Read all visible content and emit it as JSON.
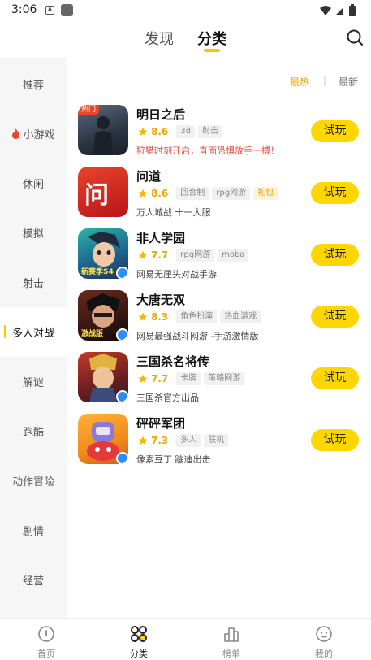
{
  "status_bar": {
    "time": "3:06",
    "notif_letter": "A"
  },
  "header": {
    "tabs": [
      {
        "label": "发现"
      },
      {
        "label": "分类"
      }
    ]
  },
  "sidebar": {
    "items": [
      {
        "label": "推荐"
      },
      {
        "label": "小游戏"
      },
      {
        "label": "休闲"
      },
      {
        "label": "模拟"
      },
      {
        "label": "射击"
      },
      {
        "label": "多人对战"
      },
      {
        "label": "解谜"
      },
      {
        "label": "跑酷"
      },
      {
        "label": "动作冒险"
      },
      {
        "label": "剧情"
      },
      {
        "label": "经营"
      }
    ],
    "active_index": 5
  },
  "sort": {
    "hot": "最热",
    "separator": "|",
    "new": "最新"
  },
  "games": [
    {
      "name": "明日之后",
      "rating": "8.6",
      "tags": [
        "3d",
        "射击"
      ],
      "desc": "狩猎时刻开启，直面恐惧放手一搏！",
      "badge": "热门",
      "button": "试玩"
    },
    {
      "name": "问道",
      "rating": "8.6",
      "tags": [
        "回合制",
        "rpg网游",
        "礼包"
      ],
      "desc": "万人城战 十一大服",
      "icon_text": "问道",
      "button": "试玩"
    },
    {
      "name": "非人学园",
      "rating": "7.7",
      "tags": [
        "rpg网游",
        "moba"
      ],
      "desc": "网易无厘头对战手游",
      "icon_text": "新赛季S4",
      "button": "试玩"
    },
    {
      "name": "大唐无双",
      "rating": "8.3",
      "tags": [
        "角色扮演",
        "热血游戏"
      ],
      "desc": "网易最强战斗网游 -手游激情版",
      "icon_text": "激战版",
      "button": "试玩"
    },
    {
      "name": "三国杀名将传",
      "rating": "7.7",
      "tags": [
        "卡牌",
        "策略网游"
      ],
      "desc": "三国杀官方出品",
      "button": "试玩"
    },
    {
      "name": "砰砰军团",
      "rating": "7.3",
      "tags": [
        "多人",
        "联机"
      ],
      "desc": "像素豆丁 蹦迪出击",
      "button": "试玩"
    }
  ],
  "bottom_nav": [
    {
      "label": "首页",
      "icon": "home-icon"
    },
    {
      "label": "分类",
      "icon": "category-icon"
    },
    {
      "label": "榜单",
      "icon": "ranking-icon"
    },
    {
      "label": "我的",
      "icon": "profile-icon"
    }
  ],
  "colors": {
    "accent": "#FFD600",
    "accent_text": "#F2A500",
    "hot_red": "#E8462E"
  }
}
